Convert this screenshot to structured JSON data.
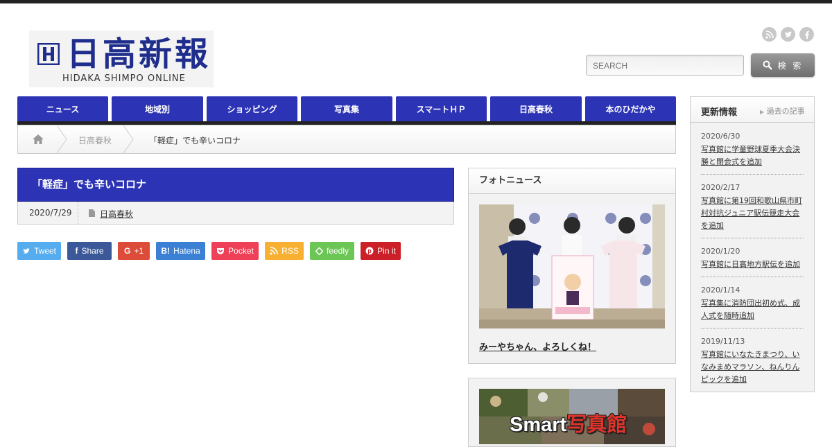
{
  "logo": {
    "kanji": "日高新報",
    "english": "HIDAKA SHIMPO ONLINE"
  },
  "social": [
    "rss-icon",
    "twitter-icon",
    "facebook-icon"
  ],
  "search": {
    "placeholder": "SEARCH",
    "button_label": "検 索"
  },
  "nav": {
    "items": [
      "ニュース",
      "地域別",
      "ショッピング",
      "写真集",
      "スマートＨＰ",
      "日高春秋",
      "本のひだかや"
    ]
  },
  "breadcrumb": {
    "category": "日高春秋",
    "current": "「軽症」でも辛いコロナ"
  },
  "article": {
    "title": "「軽症」でも辛いコロナ",
    "date": "2020/7/29",
    "category": "日高春秋"
  },
  "share": {
    "tweet": "Tweet",
    "facebook": "Share",
    "gplus": "+1",
    "hatena": "Hatena",
    "pocket": "Pocket",
    "rss": "RSS",
    "feedly": "feedly",
    "pinterest": "Pin it"
  },
  "photo_news": {
    "title": "フォトニュース",
    "caption": "みーやちゃん、よろしくね！"
  },
  "smart_banner": {
    "text_latin": "Smart",
    "text_kanji": "写真館"
  },
  "updates": {
    "title": "更新情報",
    "past_link": "過去の記事",
    "items": [
      {
        "date": "2020/6/30",
        "text": "写真館に学童野球夏季大会決勝と閉会式を追加"
      },
      {
        "date": "2020/2/17",
        "text": "写真館に第19回和歌山県市町村対抗ジュニア駅伝競走大会を追加"
      },
      {
        "date": "2020/1/20",
        "text": "写真館に日高地方駅伝を追加"
      },
      {
        "date": "2020/1/14",
        "text": "写真集に消防団出初め式、成人式を随時追加"
      },
      {
        "date": "2019/11/13",
        "text": "写真館にいなたきまつり、いなみまめマラソン、ねんりんピックを追加"
      }
    ]
  },
  "colors": {
    "nav_blue": "#2c33b5",
    "twitter": "#55acee",
    "facebook": "#3b5998",
    "gplus": "#dd4b39",
    "hatena": "#3b80d5",
    "pocket": "#ee4056",
    "rss": "#f8b031",
    "feedly": "#6cc655",
    "pinterest": "#cb2027"
  }
}
